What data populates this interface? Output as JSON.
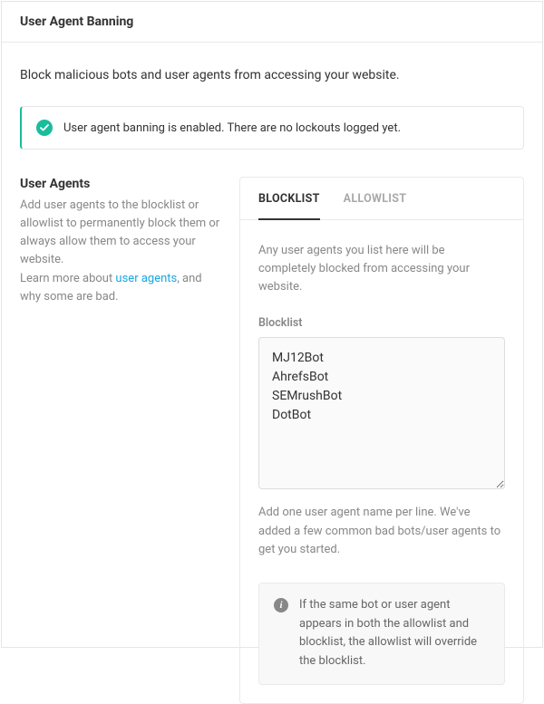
{
  "header": {
    "title": "User Agent Banning"
  },
  "intro": "Block malicious bots and user agents from accessing your website.",
  "notice": {
    "text": "User agent banning is enabled. There are no lockouts logged yet."
  },
  "sidebar": {
    "heading": "User Agents",
    "desc_before": "Add user agents to the blocklist or allowlist to permanently block them or always allow them to access your website.",
    "learn_prefix": "Learn more about ",
    "learn_link": "user agents",
    "learn_suffix": ", and why some are bad."
  },
  "tabs": {
    "blocklist": "BLOCKLIST",
    "allowlist": "ALLOWLIST",
    "active": "blocklist"
  },
  "blocklist_tab": {
    "desc": "Any user agents you list here will be completely blocked from accessing your website.",
    "field_label": "Blocklist",
    "value": "MJ12Bot\nAhrefsBot\nSEMrushBot\nDotBot",
    "help": "Add one user agent name per line. We've added a few common bad bots/user agents to get you started.",
    "info": "If the same bot or user agent appears in both the allowlist and blocklist, the allowlist will override the blocklist."
  }
}
